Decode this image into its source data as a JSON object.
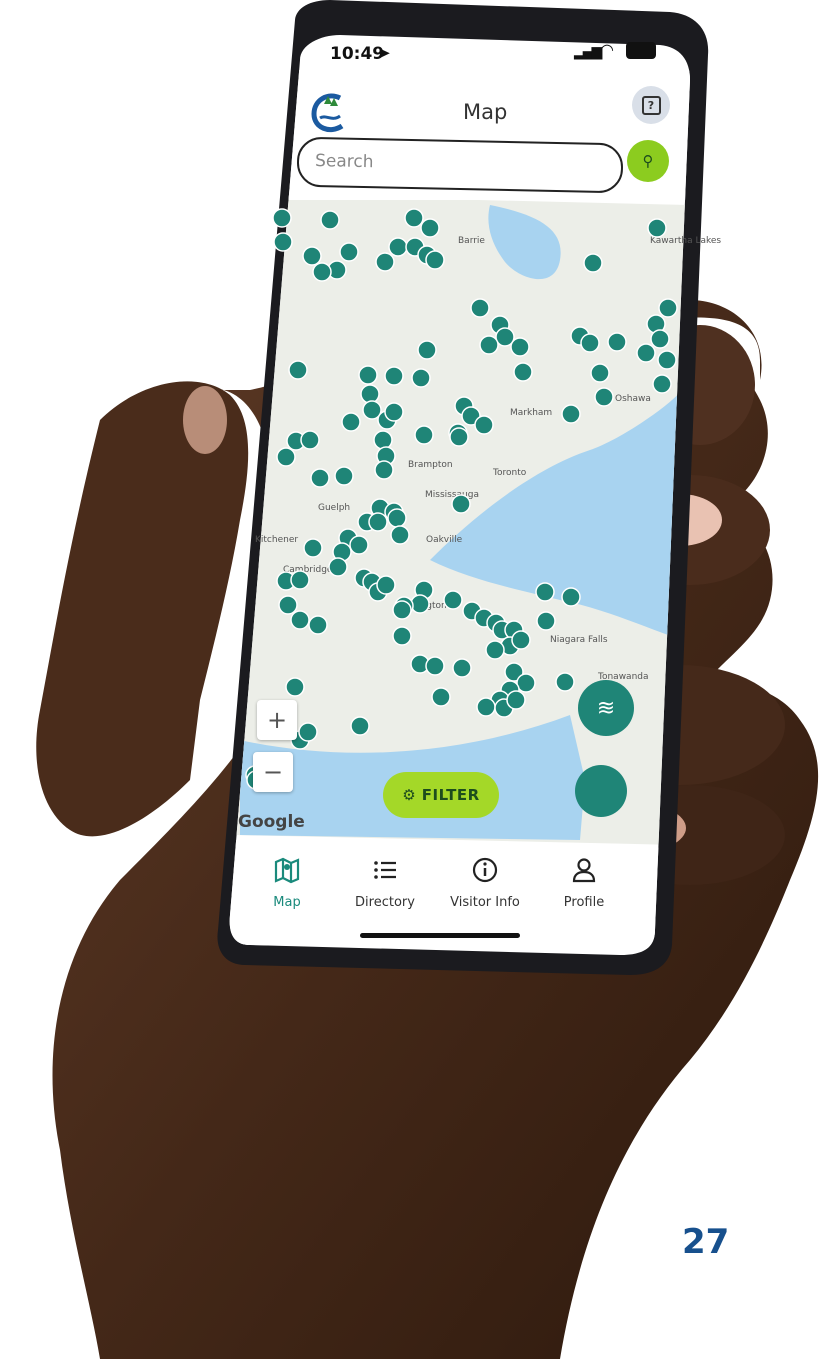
{
  "status_bar": {
    "time": "10:49"
  },
  "header": {
    "title": "Map"
  },
  "search": {
    "placeholder": "Search"
  },
  "map": {
    "labels": [
      "Barrie",
      "Kawartha Lakes",
      "Markham",
      "Oshawa",
      "Brampton",
      "Toronto",
      "Mississauga",
      "Guelph",
      "Kitchener",
      "Oakville",
      "Cambridge",
      "Burlington",
      "Niagara Falls",
      "Tonawanda"
    ],
    "attribution": "Google",
    "zoom_in": "+",
    "zoom_out": "−"
  },
  "filter": {
    "label": "FILTER"
  },
  "bottom_nav": {
    "items": [
      {
        "label": "Map",
        "icon": "map-icon",
        "active": true
      },
      {
        "label": "Directory",
        "icon": "list-icon",
        "active": false
      },
      {
        "label": "Visitor Info",
        "icon": "info-icon",
        "active": false
      },
      {
        "label": "Profile",
        "icon": "person-icon",
        "active": false
      }
    ]
  },
  "page_number": "27",
  "colors": {
    "accent": "#8ccc1f",
    "marker": "#1f8577",
    "nav_active": "#1a8a7c",
    "map_water": "#a8d3f0",
    "map_land": "#eceee8"
  }
}
